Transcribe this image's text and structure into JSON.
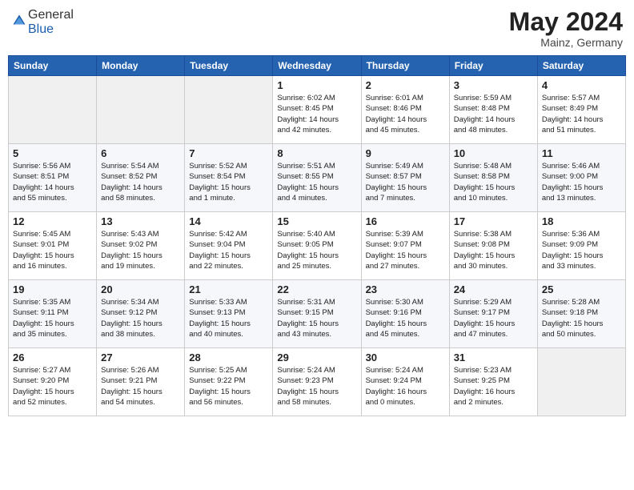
{
  "header": {
    "logo_general": "General",
    "logo_blue": "Blue",
    "month": "May 2024",
    "location": "Mainz, Germany"
  },
  "days_of_week": [
    "Sunday",
    "Monday",
    "Tuesday",
    "Wednesday",
    "Thursday",
    "Friday",
    "Saturday"
  ],
  "weeks": [
    [
      {
        "day": "",
        "info": ""
      },
      {
        "day": "",
        "info": ""
      },
      {
        "day": "",
        "info": ""
      },
      {
        "day": "1",
        "info": "Sunrise: 6:02 AM\nSunset: 8:45 PM\nDaylight: 14 hours\nand 42 minutes."
      },
      {
        "day": "2",
        "info": "Sunrise: 6:01 AM\nSunset: 8:46 PM\nDaylight: 14 hours\nand 45 minutes."
      },
      {
        "day": "3",
        "info": "Sunrise: 5:59 AM\nSunset: 8:48 PM\nDaylight: 14 hours\nand 48 minutes."
      },
      {
        "day": "4",
        "info": "Sunrise: 5:57 AM\nSunset: 8:49 PM\nDaylight: 14 hours\nand 51 minutes."
      }
    ],
    [
      {
        "day": "5",
        "info": "Sunrise: 5:56 AM\nSunset: 8:51 PM\nDaylight: 14 hours\nand 55 minutes."
      },
      {
        "day": "6",
        "info": "Sunrise: 5:54 AM\nSunset: 8:52 PM\nDaylight: 14 hours\nand 58 minutes."
      },
      {
        "day": "7",
        "info": "Sunrise: 5:52 AM\nSunset: 8:54 PM\nDaylight: 15 hours\nand 1 minute."
      },
      {
        "day": "8",
        "info": "Sunrise: 5:51 AM\nSunset: 8:55 PM\nDaylight: 15 hours\nand 4 minutes."
      },
      {
        "day": "9",
        "info": "Sunrise: 5:49 AM\nSunset: 8:57 PM\nDaylight: 15 hours\nand 7 minutes."
      },
      {
        "day": "10",
        "info": "Sunrise: 5:48 AM\nSunset: 8:58 PM\nDaylight: 15 hours\nand 10 minutes."
      },
      {
        "day": "11",
        "info": "Sunrise: 5:46 AM\nSunset: 9:00 PM\nDaylight: 15 hours\nand 13 minutes."
      }
    ],
    [
      {
        "day": "12",
        "info": "Sunrise: 5:45 AM\nSunset: 9:01 PM\nDaylight: 15 hours\nand 16 minutes."
      },
      {
        "day": "13",
        "info": "Sunrise: 5:43 AM\nSunset: 9:02 PM\nDaylight: 15 hours\nand 19 minutes."
      },
      {
        "day": "14",
        "info": "Sunrise: 5:42 AM\nSunset: 9:04 PM\nDaylight: 15 hours\nand 22 minutes."
      },
      {
        "day": "15",
        "info": "Sunrise: 5:40 AM\nSunset: 9:05 PM\nDaylight: 15 hours\nand 25 minutes."
      },
      {
        "day": "16",
        "info": "Sunrise: 5:39 AM\nSunset: 9:07 PM\nDaylight: 15 hours\nand 27 minutes."
      },
      {
        "day": "17",
        "info": "Sunrise: 5:38 AM\nSunset: 9:08 PM\nDaylight: 15 hours\nand 30 minutes."
      },
      {
        "day": "18",
        "info": "Sunrise: 5:36 AM\nSunset: 9:09 PM\nDaylight: 15 hours\nand 33 minutes."
      }
    ],
    [
      {
        "day": "19",
        "info": "Sunrise: 5:35 AM\nSunset: 9:11 PM\nDaylight: 15 hours\nand 35 minutes."
      },
      {
        "day": "20",
        "info": "Sunrise: 5:34 AM\nSunset: 9:12 PM\nDaylight: 15 hours\nand 38 minutes."
      },
      {
        "day": "21",
        "info": "Sunrise: 5:33 AM\nSunset: 9:13 PM\nDaylight: 15 hours\nand 40 minutes."
      },
      {
        "day": "22",
        "info": "Sunrise: 5:31 AM\nSunset: 9:15 PM\nDaylight: 15 hours\nand 43 minutes."
      },
      {
        "day": "23",
        "info": "Sunrise: 5:30 AM\nSunset: 9:16 PM\nDaylight: 15 hours\nand 45 minutes."
      },
      {
        "day": "24",
        "info": "Sunrise: 5:29 AM\nSunset: 9:17 PM\nDaylight: 15 hours\nand 47 minutes."
      },
      {
        "day": "25",
        "info": "Sunrise: 5:28 AM\nSunset: 9:18 PM\nDaylight: 15 hours\nand 50 minutes."
      }
    ],
    [
      {
        "day": "26",
        "info": "Sunrise: 5:27 AM\nSunset: 9:20 PM\nDaylight: 15 hours\nand 52 minutes."
      },
      {
        "day": "27",
        "info": "Sunrise: 5:26 AM\nSunset: 9:21 PM\nDaylight: 15 hours\nand 54 minutes."
      },
      {
        "day": "28",
        "info": "Sunrise: 5:25 AM\nSunset: 9:22 PM\nDaylight: 15 hours\nand 56 minutes."
      },
      {
        "day": "29",
        "info": "Sunrise: 5:24 AM\nSunset: 9:23 PM\nDaylight: 15 hours\nand 58 minutes."
      },
      {
        "day": "30",
        "info": "Sunrise: 5:24 AM\nSunset: 9:24 PM\nDaylight: 16 hours\nand 0 minutes."
      },
      {
        "day": "31",
        "info": "Sunrise: 5:23 AM\nSunset: 9:25 PM\nDaylight: 16 hours\nand 2 minutes."
      },
      {
        "day": "",
        "info": ""
      }
    ]
  ]
}
